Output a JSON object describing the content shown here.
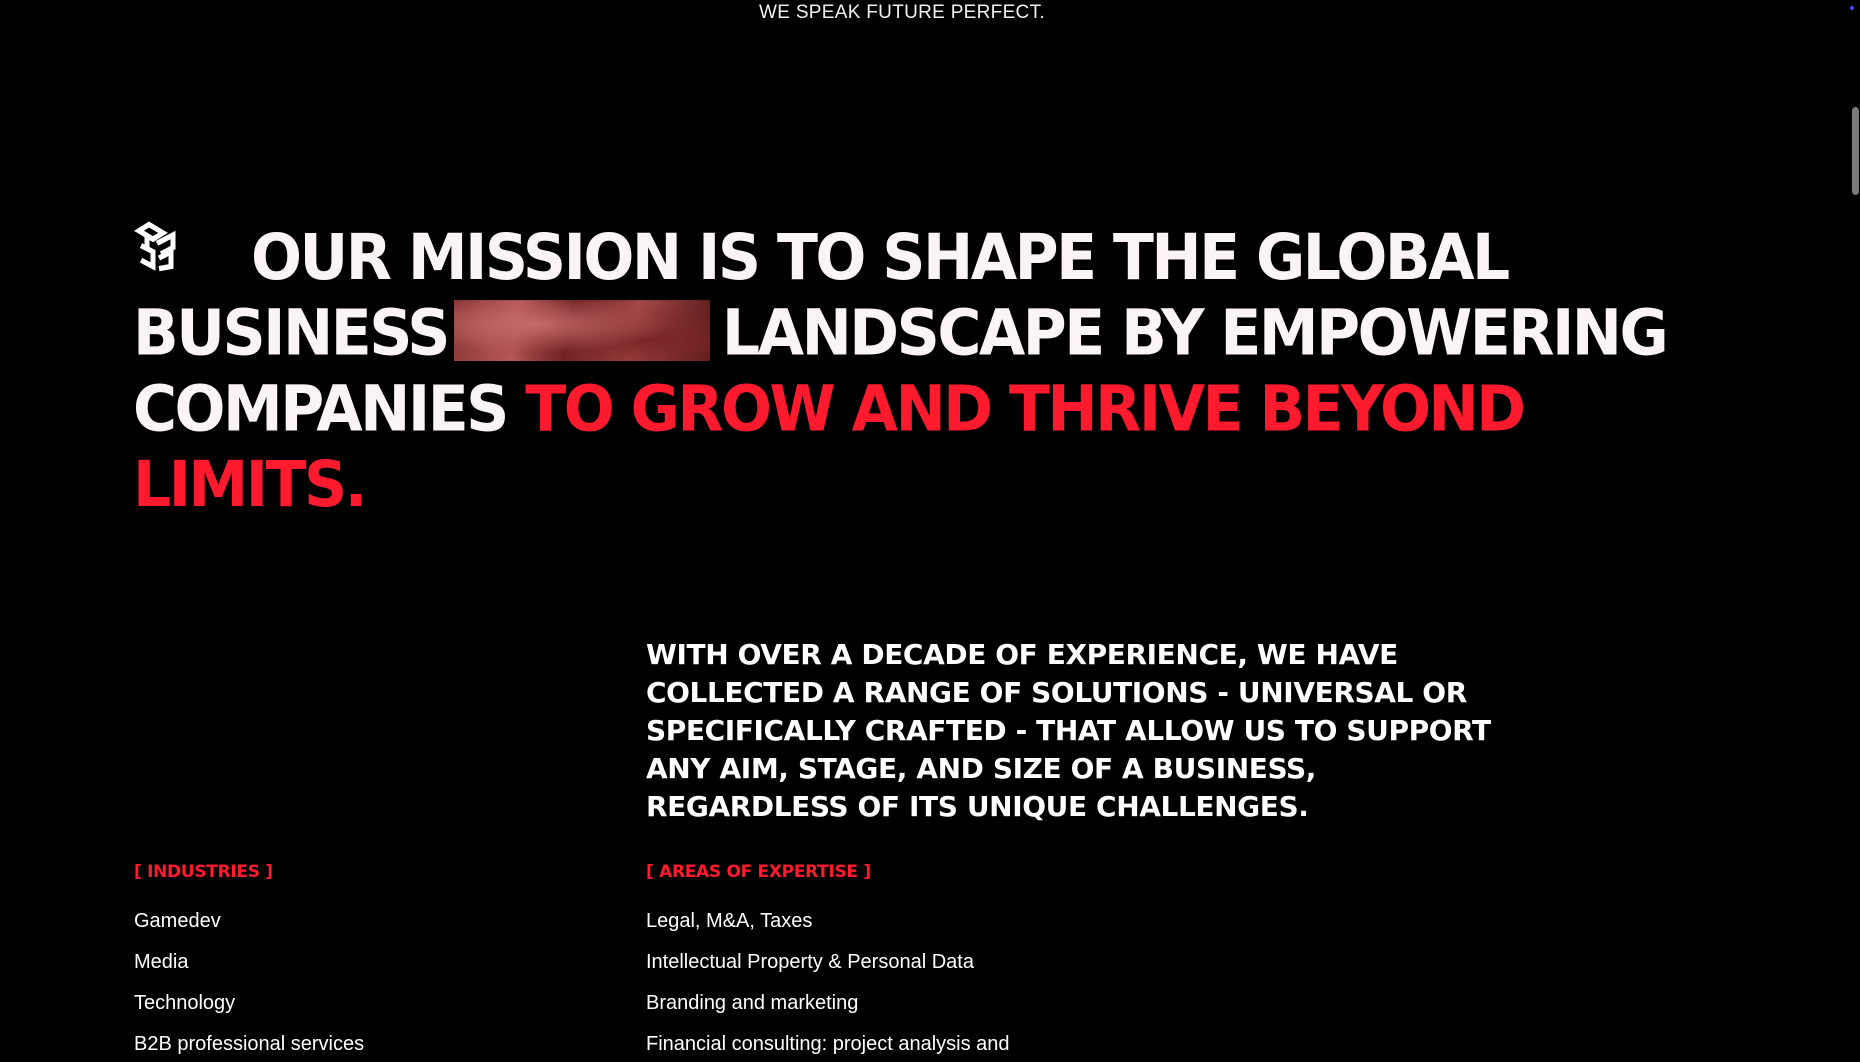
{
  "header": {
    "tagline": "WE SPEAK FUTURE PERFECT."
  },
  "mission": {
    "part1": "OUR MISSION IS TO SHAPE THE GLOBAL BUSINESS",
    "part2": "LANDSCAPE BY EMPOWERING COMPANIES",
    "accent": "TO GROW AND THRIVE BEYOND LIMITS."
  },
  "intro": {
    "text": "WITH OVER A DECADE OF EXPERIENCE, WE HAVE COLLECTED A RANGE OF SOLUTIONS - UNIVERSAL OR SPECIFICALLY CRAFTED - THAT ALLOW US TO SUPPORT ANY AIM, STAGE, AND SIZE OF A BUSINESS, REGARDLESS OF ITS UNIQUE CHALLENGES."
  },
  "industries": {
    "heading": "[ INDUSTRIES ]",
    "items": [
      "Gamedev",
      "Media",
      "Technology",
      "B2B professional services"
    ]
  },
  "expertise": {
    "heading": "[ AREAS OF EXPERTISE ]",
    "items": [
      "Legal, M&A, Taxes",
      "Intellectual Property & Personal Data",
      "Branding and marketing",
      "Financial consulting: project analysis and"
    ]
  },
  "colors": {
    "background": "#000000",
    "text": "#fbf4f6",
    "accent": "#ff1a2e"
  },
  "icons": {
    "brand": "brand-logo-icon"
  }
}
